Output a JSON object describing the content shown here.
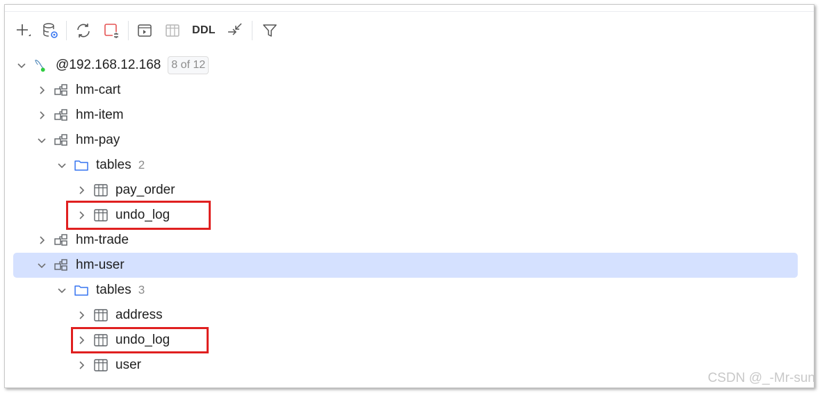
{
  "toolbar": {
    "new_icon": "plus-icon",
    "datasource_icon": "datasource-settings-icon",
    "refresh_icon": "refresh-icon",
    "disconnect_icon": "disconnect-icon",
    "console_icon": "console-icon",
    "table_icon": "table-view-icon",
    "ddl_label": "DDL",
    "jump_icon": "jump-to-source-icon",
    "filter_icon": "filter-icon"
  },
  "tree": {
    "connection": {
      "label": "@192.168.12.168",
      "badge": "8 of 12"
    },
    "nodes": [
      {
        "label": "hm-cart"
      },
      {
        "label": "hm-item"
      },
      {
        "label": "hm-pay"
      },
      {
        "label": "tables",
        "count": "2"
      },
      {
        "label": "pay_order"
      },
      {
        "label": "undo_log"
      },
      {
        "label": "hm-trade"
      },
      {
        "label": "hm-user"
      },
      {
        "label": "tables",
        "count": "3"
      },
      {
        "label": "address"
      },
      {
        "label": "undo_log"
      },
      {
        "label": "user"
      }
    ]
  },
  "colors": {
    "selection": "#d5e1ff",
    "highlight_border": "#e02020",
    "folder": "#3574f0",
    "connection_status": "#2ecc40"
  },
  "watermark": "CSDN @_-Mr-sun"
}
